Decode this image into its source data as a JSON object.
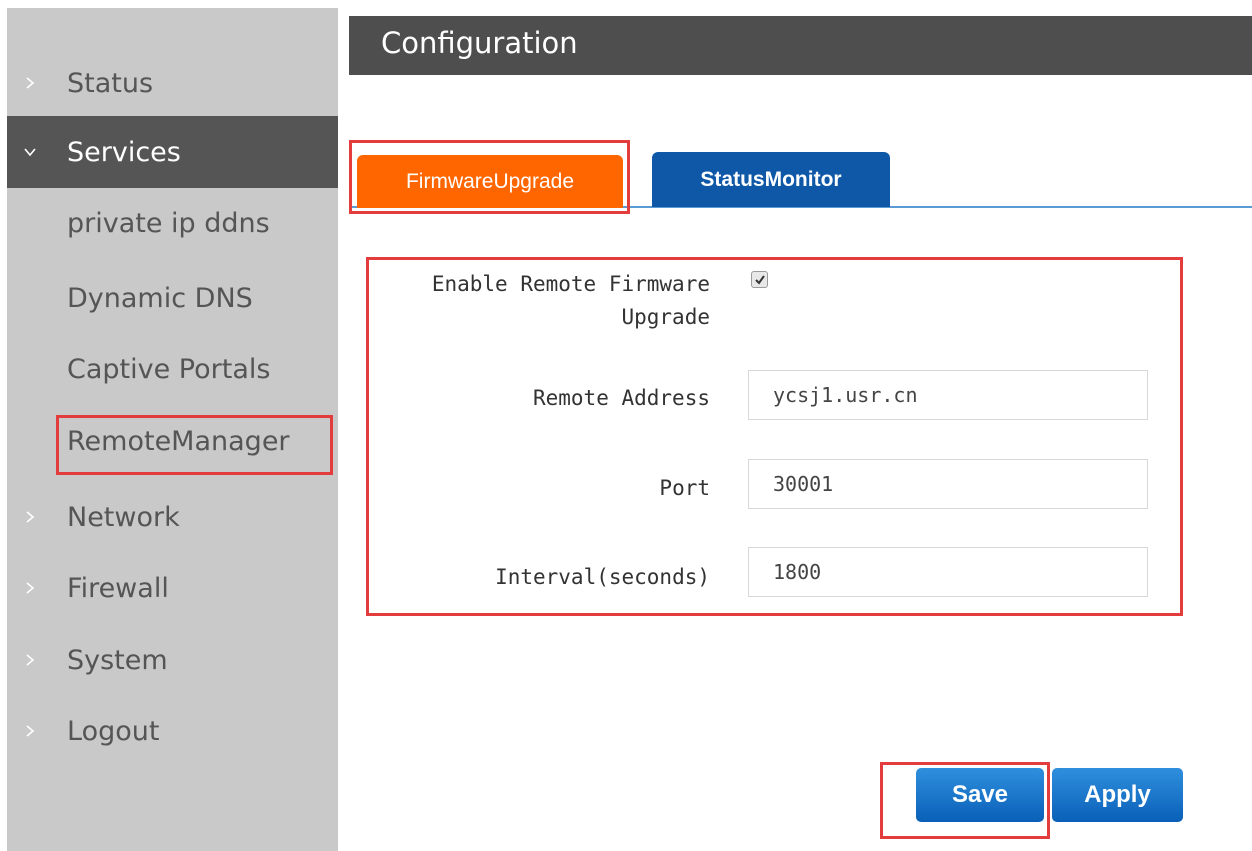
{
  "header": {
    "title": "Configuration"
  },
  "sidebar": {
    "items": [
      {
        "label": "Status",
        "expanded": false
      },
      {
        "label": "Services",
        "expanded": true
      },
      {
        "label": "Network",
        "expanded": false
      },
      {
        "label": "Firewall",
        "expanded": false
      },
      {
        "label": "System",
        "expanded": false
      },
      {
        "label": "Logout",
        "expanded": false
      }
    ],
    "services_subitems": [
      "private ip ddns",
      "Dynamic DNS",
      "Captive Portals",
      "RemoteManager"
    ]
  },
  "tabs": [
    {
      "label": "FirmwareUpgrade",
      "active": true
    },
    {
      "label": "StatusMonitor",
      "active": false
    }
  ],
  "form": {
    "enable_label_line1": "Enable Remote Firmware",
    "enable_label_line2": "Upgrade",
    "enable_checked": true,
    "remote_address_label": "Remote Address",
    "remote_address_value": "ycsj1.usr.cn",
    "port_label": "Port",
    "port_value": "30001",
    "interval_label": "Interval(seconds)",
    "interval_value": "1800"
  },
  "buttons": {
    "save": "Save",
    "apply": "Apply"
  },
  "colors": {
    "sidebar_bg": "#c9c9c9",
    "sidebar_active_bg": "#555555",
    "header_bg": "#4e4e4e",
    "tab_active": "#ff6600",
    "tab_inactive": "#0f58a8",
    "button_blue": "#0a60b8",
    "highlight_red": "#e23c3c"
  },
  "icons": {
    "collapsed": "chevron-right-icon",
    "expanded": "chevron-down-icon",
    "checkbox": "checkmark-icon"
  }
}
